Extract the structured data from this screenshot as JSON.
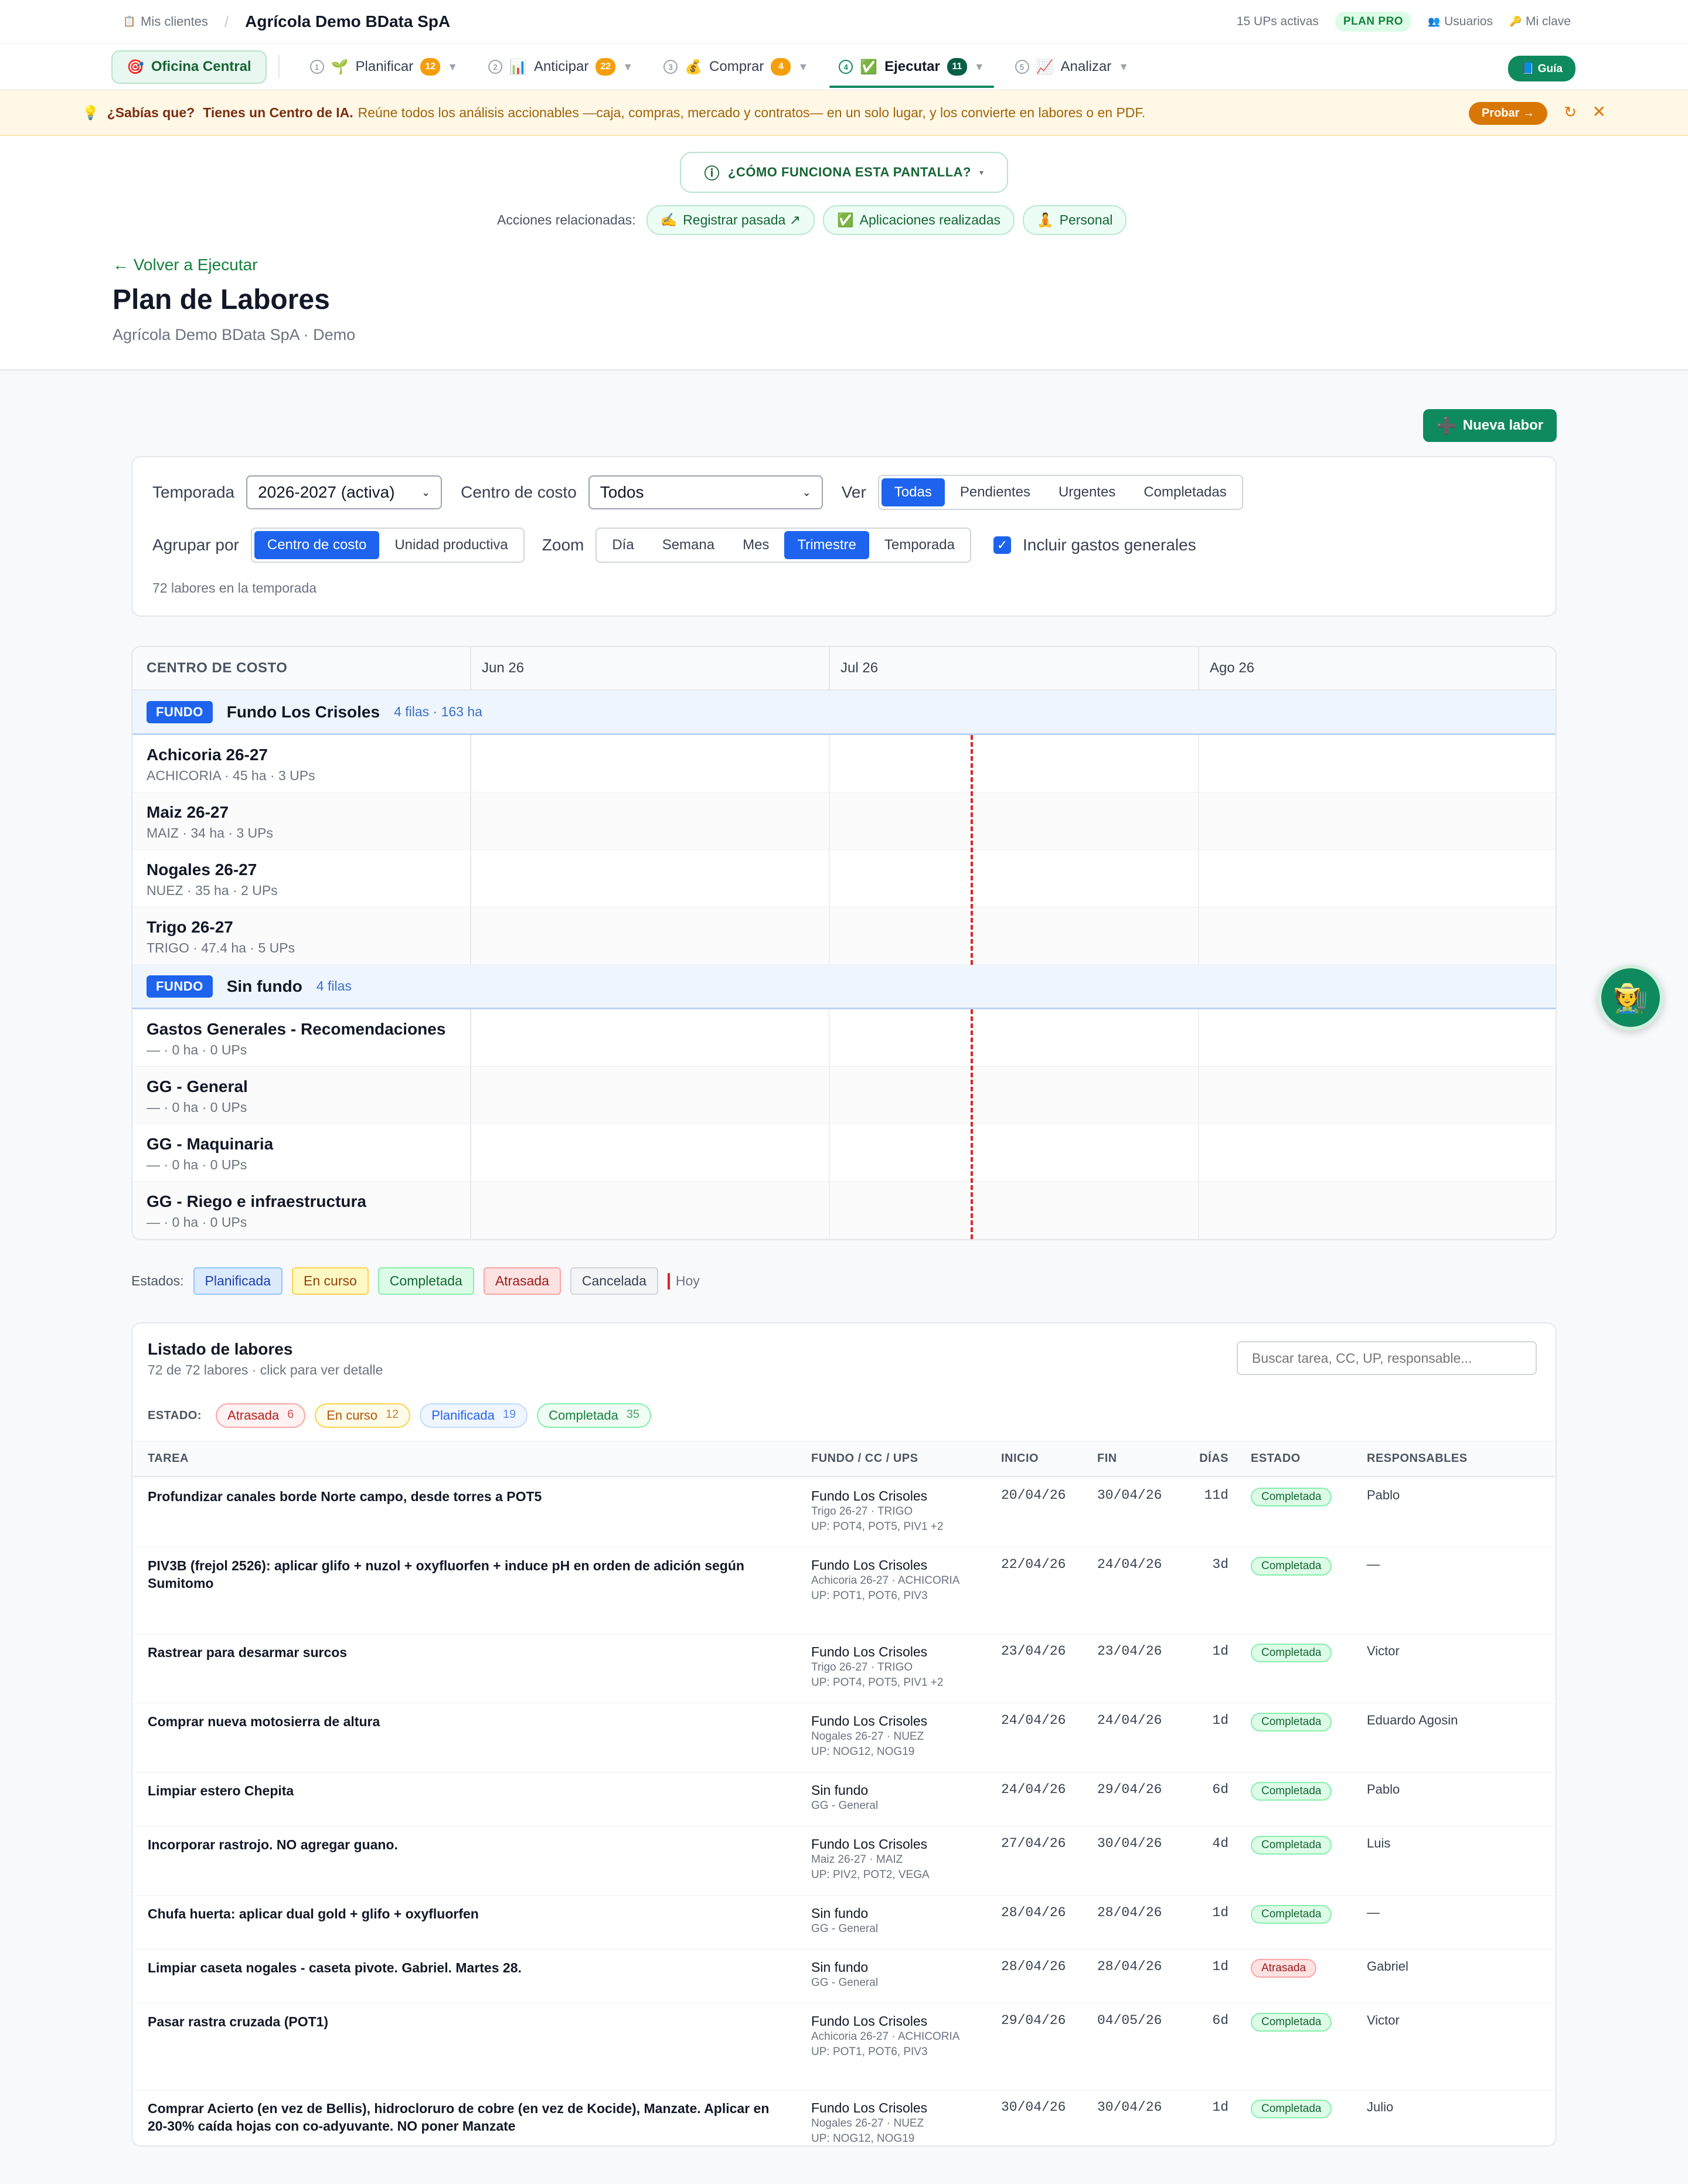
{
  "topbar": {
    "clients_label": "Mis clientes",
    "client_name": "Agrícola Demo BData SpA",
    "ups_active": "15 UPs activas",
    "plan_badge": "PLAN PRO",
    "users_label": "Usuarios",
    "password_label": "Mi clave"
  },
  "nav": {
    "home_label": "Oficina Central",
    "items": [
      {
        "num": "1",
        "label": "Planificar",
        "count": "12"
      },
      {
        "num": "2",
        "label": "Anticipar",
        "count": "22"
      },
      {
        "num": "3",
        "label": "Comprar",
        "count": "4"
      },
      {
        "num": "4",
        "label": "Ejecutar",
        "count": "11"
      },
      {
        "num": "5",
        "label": "Analizar",
        "count": ""
      }
    ],
    "guide_label": "Guía"
  },
  "tip": {
    "lead": "¿Sabías que?",
    "highlight": "Tienes un Centro de IA.",
    "text": "Reúne todos los análisis accionables —caja, compras, mercado y contratos— en un solo lugar, y los convierte en labores o en PDF.",
    "cta": "Probar →"
  },
  "header": {
    "howto": "¿CÓMO FUNCIONA ESTA PANTALLA?",
    "related_label": "Acciones relacionadas:",
    "related": [
      "Registrar pasada ↗",
      "Aplicaciones realizadas",
      "Personal"
    ],
    "back": "← Volver a Ejecutar",
    "title": "Plan de Labores",
    "subtitle": "Agrícola Demo BData SpA · Demo"
  },
  "new_task_button": "Nueva labor",
  "filters": {
    "season_label": "Temporada",
    "season_value": "2026-2027 (activa)",
    "cost_center_label": "Centro de costo",
    "cost_center_value": "Todos",
    "view_label": "Ver",
    "view_options": [
      "Todas",
      "Pendientes",
      "Urgentes",
      "Completadas"
    ],
    "view_selected": "Todas",
    "group_label": "Agrupar por",
    "group_options": [
      "Centro de costo",
      "Unidad productiva"
    ],
    "group_selected": "Centro de costo",
    "zoom_label": "Zoom",
    "zoom_options": [
      "Día",
      "Semana",
      "Mes",
      "Trimestre",
      "Temporada"
    ],
    "zoom_selected": "Trimestre",
    "include_general_label": "Incluir gastos generales",
    "include_general": true,
    "count_text": "72 labores en la temporada"
  },
  "gantt": {
    "col_header": "CENTRO DE COSTO",
    "months": [
      "Jun 26",
      "Jul 26",
      "Ago 26"
    ],
    "groups": [
      {
        "tag": "FUNDO",
        "name": "Fundo Los Crisoles",
        "meta": "4 filas · 163 ha",
        "rows": [
          {
            "name": "Achicoria 26-27",
            "meta": "ACHICORIA · 45 ha · 3 UPs"
          },
          {
            "name": "Maiz 26-27",
            "meta": "MAIZ · 34 ha · 3 UPs"
          },
          {
            "name": "Nogales 26-27",
            "meta": "NUEZ · 35 ha · 2 UPs"
          },
          {
            "name": "Trigo 26-27",
            "meta": "TRIGO · 47.4 ha · 5 UPs"
          }
        ]
      },
      {
        "tag": "FUNDO",
        "name": "Sin fundo",
        "meta": "4 filas",
        "rows": [
          {
            "name": "Gastos Generales - Recomendaciones",
            "meta": "— · 0 ha · 0 UPs"
          },
          {
            "name": "GG - General",
            "meta": "— · 0 ha · 0 UPs"
          },
          {
            "name": "GG - Maquinaria",
            "meta": "— · 0 ha · 0 UPs"
          },
          {
            "name": "GG - Riego e infraestructura",
            "meta": "— · 0 ha · 0 UPs"
          }
        ]
      }
    ]
  },
  "legend": {
    "label": "Estados:",
    "items": [
      "Planificada",
      "En curso",
      "Completada",
      "Atrasada",
      "Cancelada"
    ],
    "today": "Hoy"
  },
  "list": {
    "title": "Listado de labores",
    "subtitle": "72 de 72 labores · click para ver detalle",
    "search_placeholder": "Buscar tarea, CC, UP, responsable...",
    "estado_label": "ESTADO:",
    "filter_chips": [
      {
        "label": "Atrasada",
        "count": "6"
      },
      {
        "label": "En curso",
        "count": "12"
      },
      {
        "label": "Planificada",
        "count": "19"
      },
      {
        "label": "Completada",
        "count": "35"
      }
    ],
    "columns": [
      "TAREA",
      "FUNDO / CC / UPS",
      "INICIO",
      "FIN",
      "DÍAS",
      "ESTADO",
      "RESPONSABLES"
    ],
    "rows": [
      {
        "task": "Profundizar canales borde Norte campo, desde torres a POT5",
        "fundo": "Fundo Los Crisoles",
        "cc": "Trigo 26-27 · TRIGO",
        "ups": "UP: POT4, POT5, PIV1 +2",
        "start": "20/04/26",
        "end": "30/04/26",
        "days": "11d",
        "status": "Completada",
        "resp": "Pablo"
      },
      {
        "task": "PIV3B (frejol 2526): aplicar glifo + nuzol + oxyfluorfen + induce pH en orden de adición según Sumitomo",
        "fundo": "Fundo Los Crisoles",
        "cc": "Achicoria 26-27 · ACHICORIA",
        "ups": "UP: POT1, POT6, PIV3",
        "start": "22/04/26",
        "end": "24/04/26",
        "days": "3d",
        "status": "Completada",
        "resp": "—"
      },
      {
        "task": "Rastrear para desarmar surcos",
        "fundo": "Fundo Los Crisoles",
        "cc": "Trigo 26-27 · TRIGO",
        "ups": "UP: POT4, POT5, PIV1 +2",
        "start": "23/04/26",
        "end": "23/04/26",
        "days": "1d",
        "status": "Completada",
        "resp": "Victor"
      },
      {
        "task": "Comprar nueva motosierra de altura",
        "fundo": "Fundo Los Crisoles",
        "cc": "Nogales 26-27 · NUEZ",
        "ups": "UP: NOG12, NOG19",
        "start": "24/04/26",
        "end": "24/04/26",
        "days": "1d",
        "status": "Completada",
        "resp": "Eduardo Agosin"
      },
      {
        "task": "Limpiar estero Chepita",
        "fundo": "Sin fundo",
        "cc": "GG - General",
        "ups": "",
        "start": "24/04/26",
        "end": "29/04/26",
        "days": "6d",
        "status": "Completada",
        "resp": "Pablo"
      },
      {
        "task": "Incorporar rastrojo. NO agregar guano.",
        "fundo": "Fundo Los Crisoles",
        "cc": "Maiz 26-27 · MAIZ",
        "ups": "UP: PIV2, POT2, VEGA",
        "start": "27/04/26",
        "end": "30/04/26",
        "days": "4d",
        "status": "Completada",
        "resp": "Luis"
      },
      {
        "task": "Chufa huerta: aplicar dual gold + glifo + oxyfluorfen",
        "fundo": "Sin fundo",
        "cc": "GG - General",
        "ups": "",
        "start": "28/04/26",
        "end": "28/04/26",
        "days": "1d",
        "status": "Completada",
        "resp": "—"
      },
      {
        "task": "Limpiar caseta nogales - caseta pivote. Gabriel. Martes 28.",
        "fundo": "Sin fundo",
        "cc": "GG - General",
        "ups": "",
        "start": "28/04/26",
        "end": "28/04/26",
        "days": "1d",
        "status": "Atrasada",
        "resp": "Gabriel"
      },
      {
        "task": "Pasar rastra cruzada (POT1)",
        "fundo": "Fundo Los Crisoles",
        "cc": "Achicoria 26-27 · ACHICORIA",
        "ups": "UP: POT1, POT6, PIV3",
        "start": "29/04/26",
        "end": "04/05/26",
        "days": "6d",
        "status": "Completada",
        "resp": "Victor"
      },
      {
        "task": "Comprar Acierto (en vez de Bellis), hidrocloruro de cobre (en vez de Kocide), Manzate. Aplicar en 20-30% caída hojas con co-adyuvante. NO poner Manzate",
        "fundo": "Fundo Los Crisoles",
        "cc": "Nogales 26-27 · NUEZ",
        "ups": "UP: NOG12, NOG19",
        "start": "30/04/26",
        "end": "30/04/26",
        "days": "1d",
        "status": "Completada",
        "resp": "Julio"
      }
    ]
  },
  "colors": {
    "primary_green": "#0f8a5f",
    "accent_blue": "#1d63ed",
    "today_red": "#dc2626",
    "warning_orange": "#f59e0b"
  }
}
